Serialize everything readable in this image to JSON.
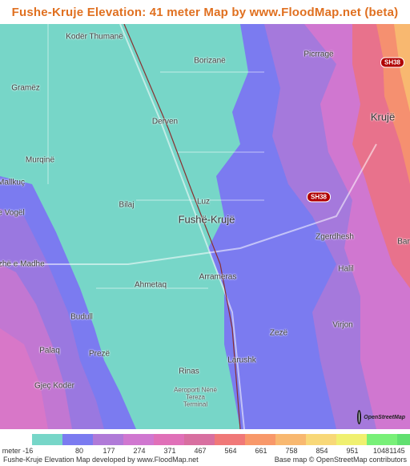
{
  "title": "Fushe-Kruje Elevation: 41 meter Map by www.FloodMap.net (beta)",
  "places": [
    {
      "name": "Kodër Thumanë",
      "cls": ""
    },
    {
      "name": "Borizanë",
      "cls": ""
    },
    {
      "name": "Picrragë",
      "cls": ""
    },
    {
      "name": "Gramëz",
      "cls": ""
    },
    {
      "name": "Derven",
      "cls": ""
    },
    {
      "name": "Krujë",
      "cls": "big"
    },
    {
      "name": "Murqinë",
      "cls": ""
    },
    {
      "name": "Mallkuç",
      "cls": ""
    },
    {
      "name": "Luz",
      "cls": ""
    },
    {
      "name": "Bilaj",
      "cls": ""
    },
    {
      "name": "Fushë-Krujë",
      "cls": "big"
    },
    {
      "name": "e Vogël",
      "cls": ""
    },
    {
      "name": "Zgerdhesh",
      "cls": ""
    },
    {
      "name": "Halil",
      "cls": ""
    },
    {
      "name": "Bar",
      "cls": ""
    },
    {
      "name": "azhë e Madhe",
      "cls": ""
    },
    {
      "name": "Ahmetaq",
      "cls": ""
    },
    {
      "name": "Arrameras",
      "cls": ""
    },
    {
      "name": "Budull",
      "cls": ""
    },
    {
      "name": "Zezë",
      "cls": ""
    },
    {
      "name": "Virjon",
      "cls": ""
    },
    {
      "name": "Larushk",
      "cls": ""
    },
    {
      "name": "Palaq",
      "cls": ""
    },
    {
      "name": "Prezë",
      "cls": ""
    },
    {
      "name": "Rinas",
      "cls": ""
    },
    {
      "name": "Gjeç Kodër",
      "cls": ""
    },
    {
      "name": "Aeroporti Nënë Tereza Terminal",
      "cls": "tiny"
    }
  ],
  "road_shields": [
    "SH38",
    "SH38"
  ],
  "osm_logo_text": "OpenStreetMap",
  "legend": {
    "unit_label": "meter -16",
    "ticks": [
      "80",
      "177",
      "274",
      "371",
      "467",
      "564",
      "661",
      "758",
      "854",
      "951",
      "1048",
      "1145"
    ],
    "colors": [
      "#77d6c8",
      "#7b7bf0",
      "#b07ad8",
      "#d077d0",
      "#e070b8",
      "#d86fa0",
      "#f07878",
      "#f8986a",
      "#f8b870",
      "#f8d878",
      "#f0f070",
      "#78f078",
      "#60e070"
    ]
  },
  "footer": {
    "left": "Fushe-Kruje Elevation Map developed by www.FloodMap.net",
    "right": "Base map © OpenStreetMap contributors"
  }
}
